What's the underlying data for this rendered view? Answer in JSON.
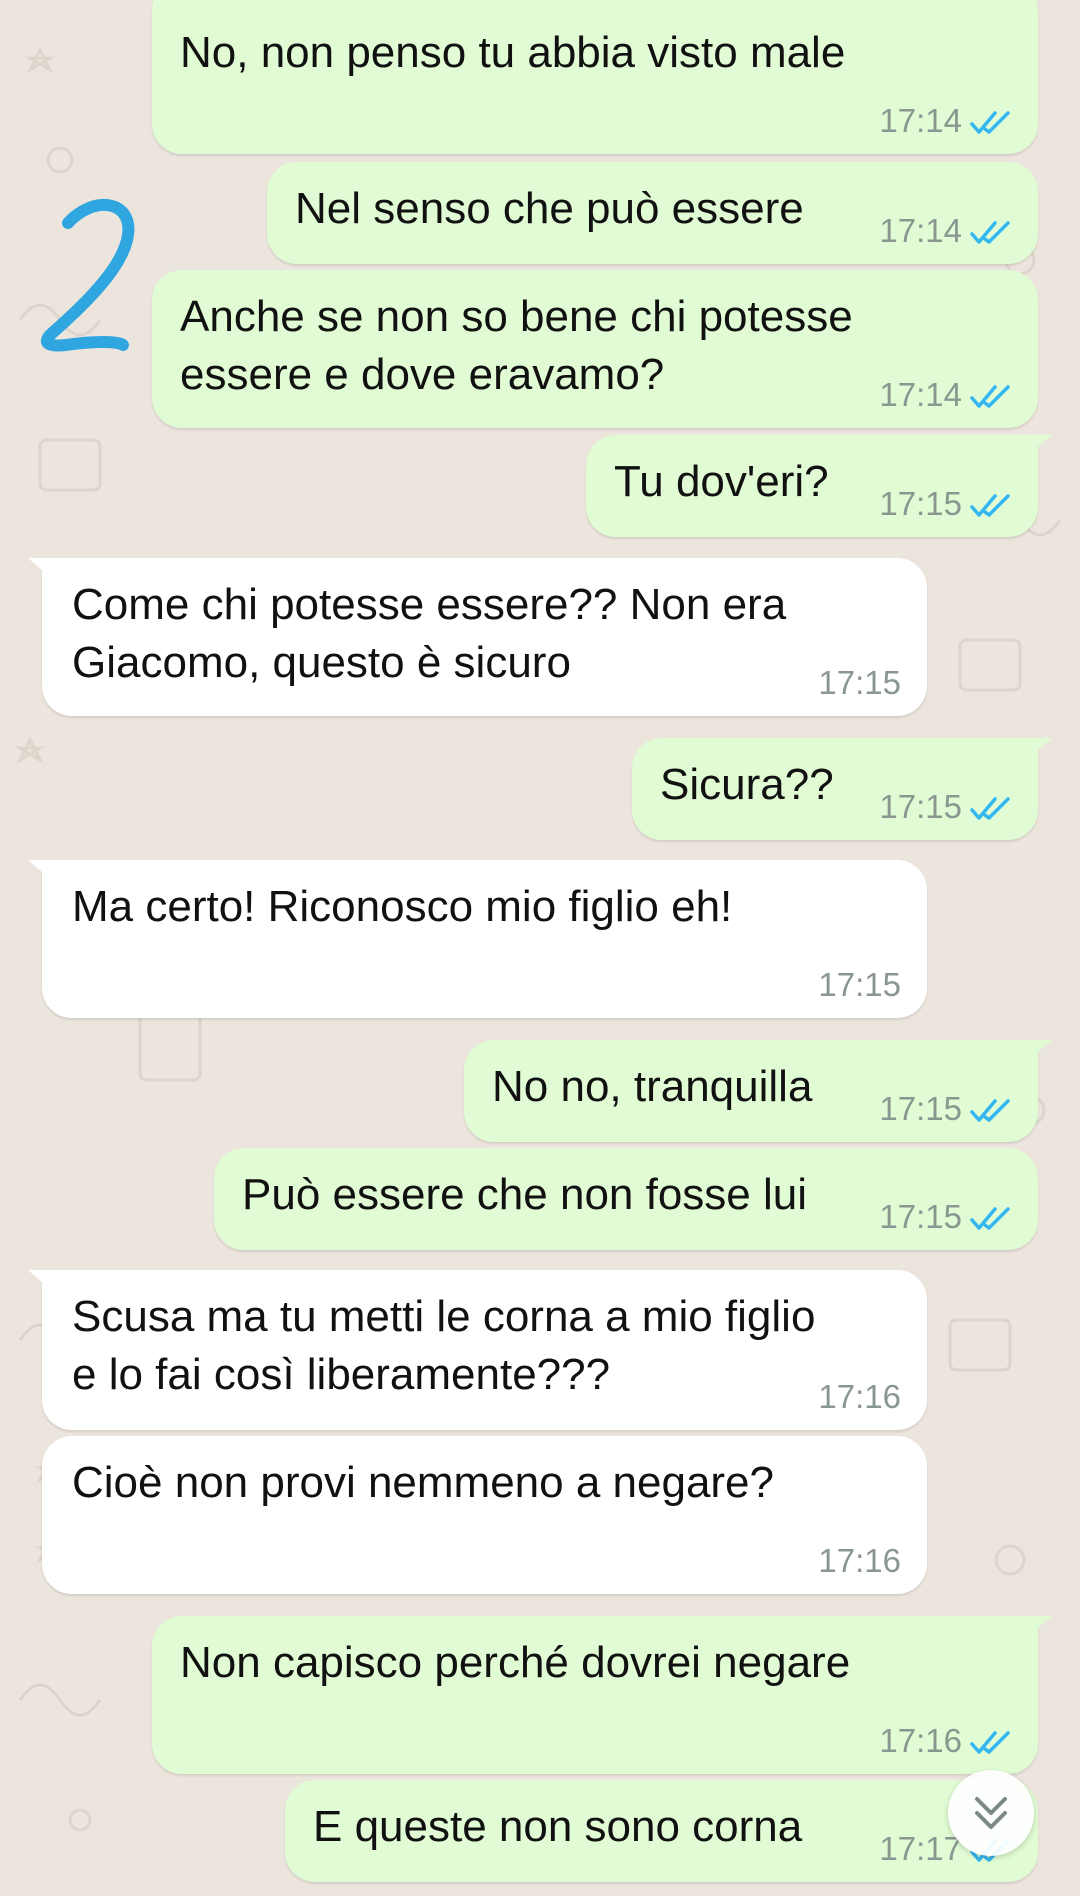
{
  "colors": {
    "chat_background": "#ece5dd",
    "outgoing_bubble": "#e1fcd4",
    "incoming_bubble": "#ffffff",
    "read_ticks": "#34b7f1",
    "timestamp": "#8a9790",
    "annotation_ink": "#2fa6e0"
  },
  "annotation": {
    "label": "2"
  },
  "messages": [
    {
      "dir": "out",
      "text": "No, non penso tu abbia visto male",
      "time": "17:14",
      "status": "read"
    },
    {
      "dir": "out",
      "text": "Nel senso che può essere",
      "time": "17:14",
      "status": "read"
    },
    {
      "dir": "out",
      "text": "Anche se non so bene chi potesse\nessere e dove eravamo?",
      "time": "17:14",
      "status": "read"
    },
    {
      "dir": "out",
      "text": "Tu dov'eri?",
      "time": "17:15",
      "status": "read"
    },
    {
      "dir": "in",
      "text": "Come chi potesse essere?? Non era\nGiacomo, questo è sicuro",
      "time": "17:15"
    },
    {
      "dir": "out",
      "text": "Sicura??",
      "time": "17:15",
      "status": "read"
    },
    {
      "dir": "in",
      "text": "Ma certo! Riconosco mio figlio eh!",
      "time": "17:15"
    },
    {
      "dir": "out",
      "text": "No no, tranquilla",
      "time": "17:15",
      "status": "read"
    },
    {
      "dir": "out",
      "text": "Può essere che non fosse lui",
      "time": "17:15",
      "status": "read"
    },
    {
      "dir": "in",
      "text": "Scusa ma tu metti le corna a mio figlio\ne lo fai così liberamente???",
      "time": "17:16"
    },
    {
      "dir": "in",
      "text": "Cioè non provi nemmeno a negare?",
      "time": "17:16"
    },
    {
      "dir": "out",
      "text": "Non capisco perché dovrei negare",
      "time": "17:16",
      "status": "read"
    },
    {
      "dir": "out",
      "text": "E queste non sono corna",
      "time": "17:17",
      "status": "read"
    }
  ],
  "icons": {
    "read_receipt": "double-check-icon",
    "scroll_down": "chevron-double-down-icon"
  }
}
